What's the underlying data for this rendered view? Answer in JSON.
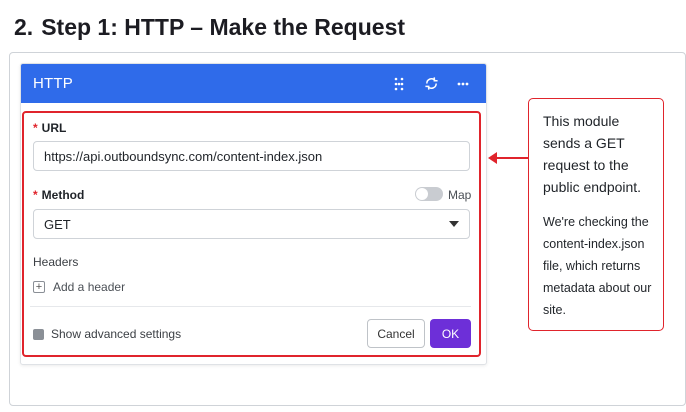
{
  "heading": {
    "number": "2.",
    "text": "Step 1: HTTP – Make the Request"
  },
  "panel": {
    "title": "HTTP",
    "icons": [
      "grid-dots-icon",
      "refresh-icon",
      "more-icon"
    ]
  },
  "url": {
    "label": "URL",
    "required_mark": "*",
    "value": "https://api.outboundsync.com/content-index.json"
  },
  "method": {
    "label": "Method",
    "required_mark": "*",
    "value": "GET",
    "map_label": "Map"
  },
  "headers": {
    "label": "Headers",
    "add_label": "Add a header",
    "plus_glyph": "+"
  },
  "footer": {
    "advanced_label": "Show advanced settings",
    "cancel_label": "Cancel",
    "ok_label": "OK"
  },
  "callout": {
    "p1": "This module sends a GET request to the public endpoint.",
    "p2": "We're checking the content-index.json file, which returns metadata about our site."
  },
  "colors": {
    "header_blue": "#2f6bea",
    "highlight_red": "#e0242c",
    "ok_purple": "#6d2fd8"
  }
}
